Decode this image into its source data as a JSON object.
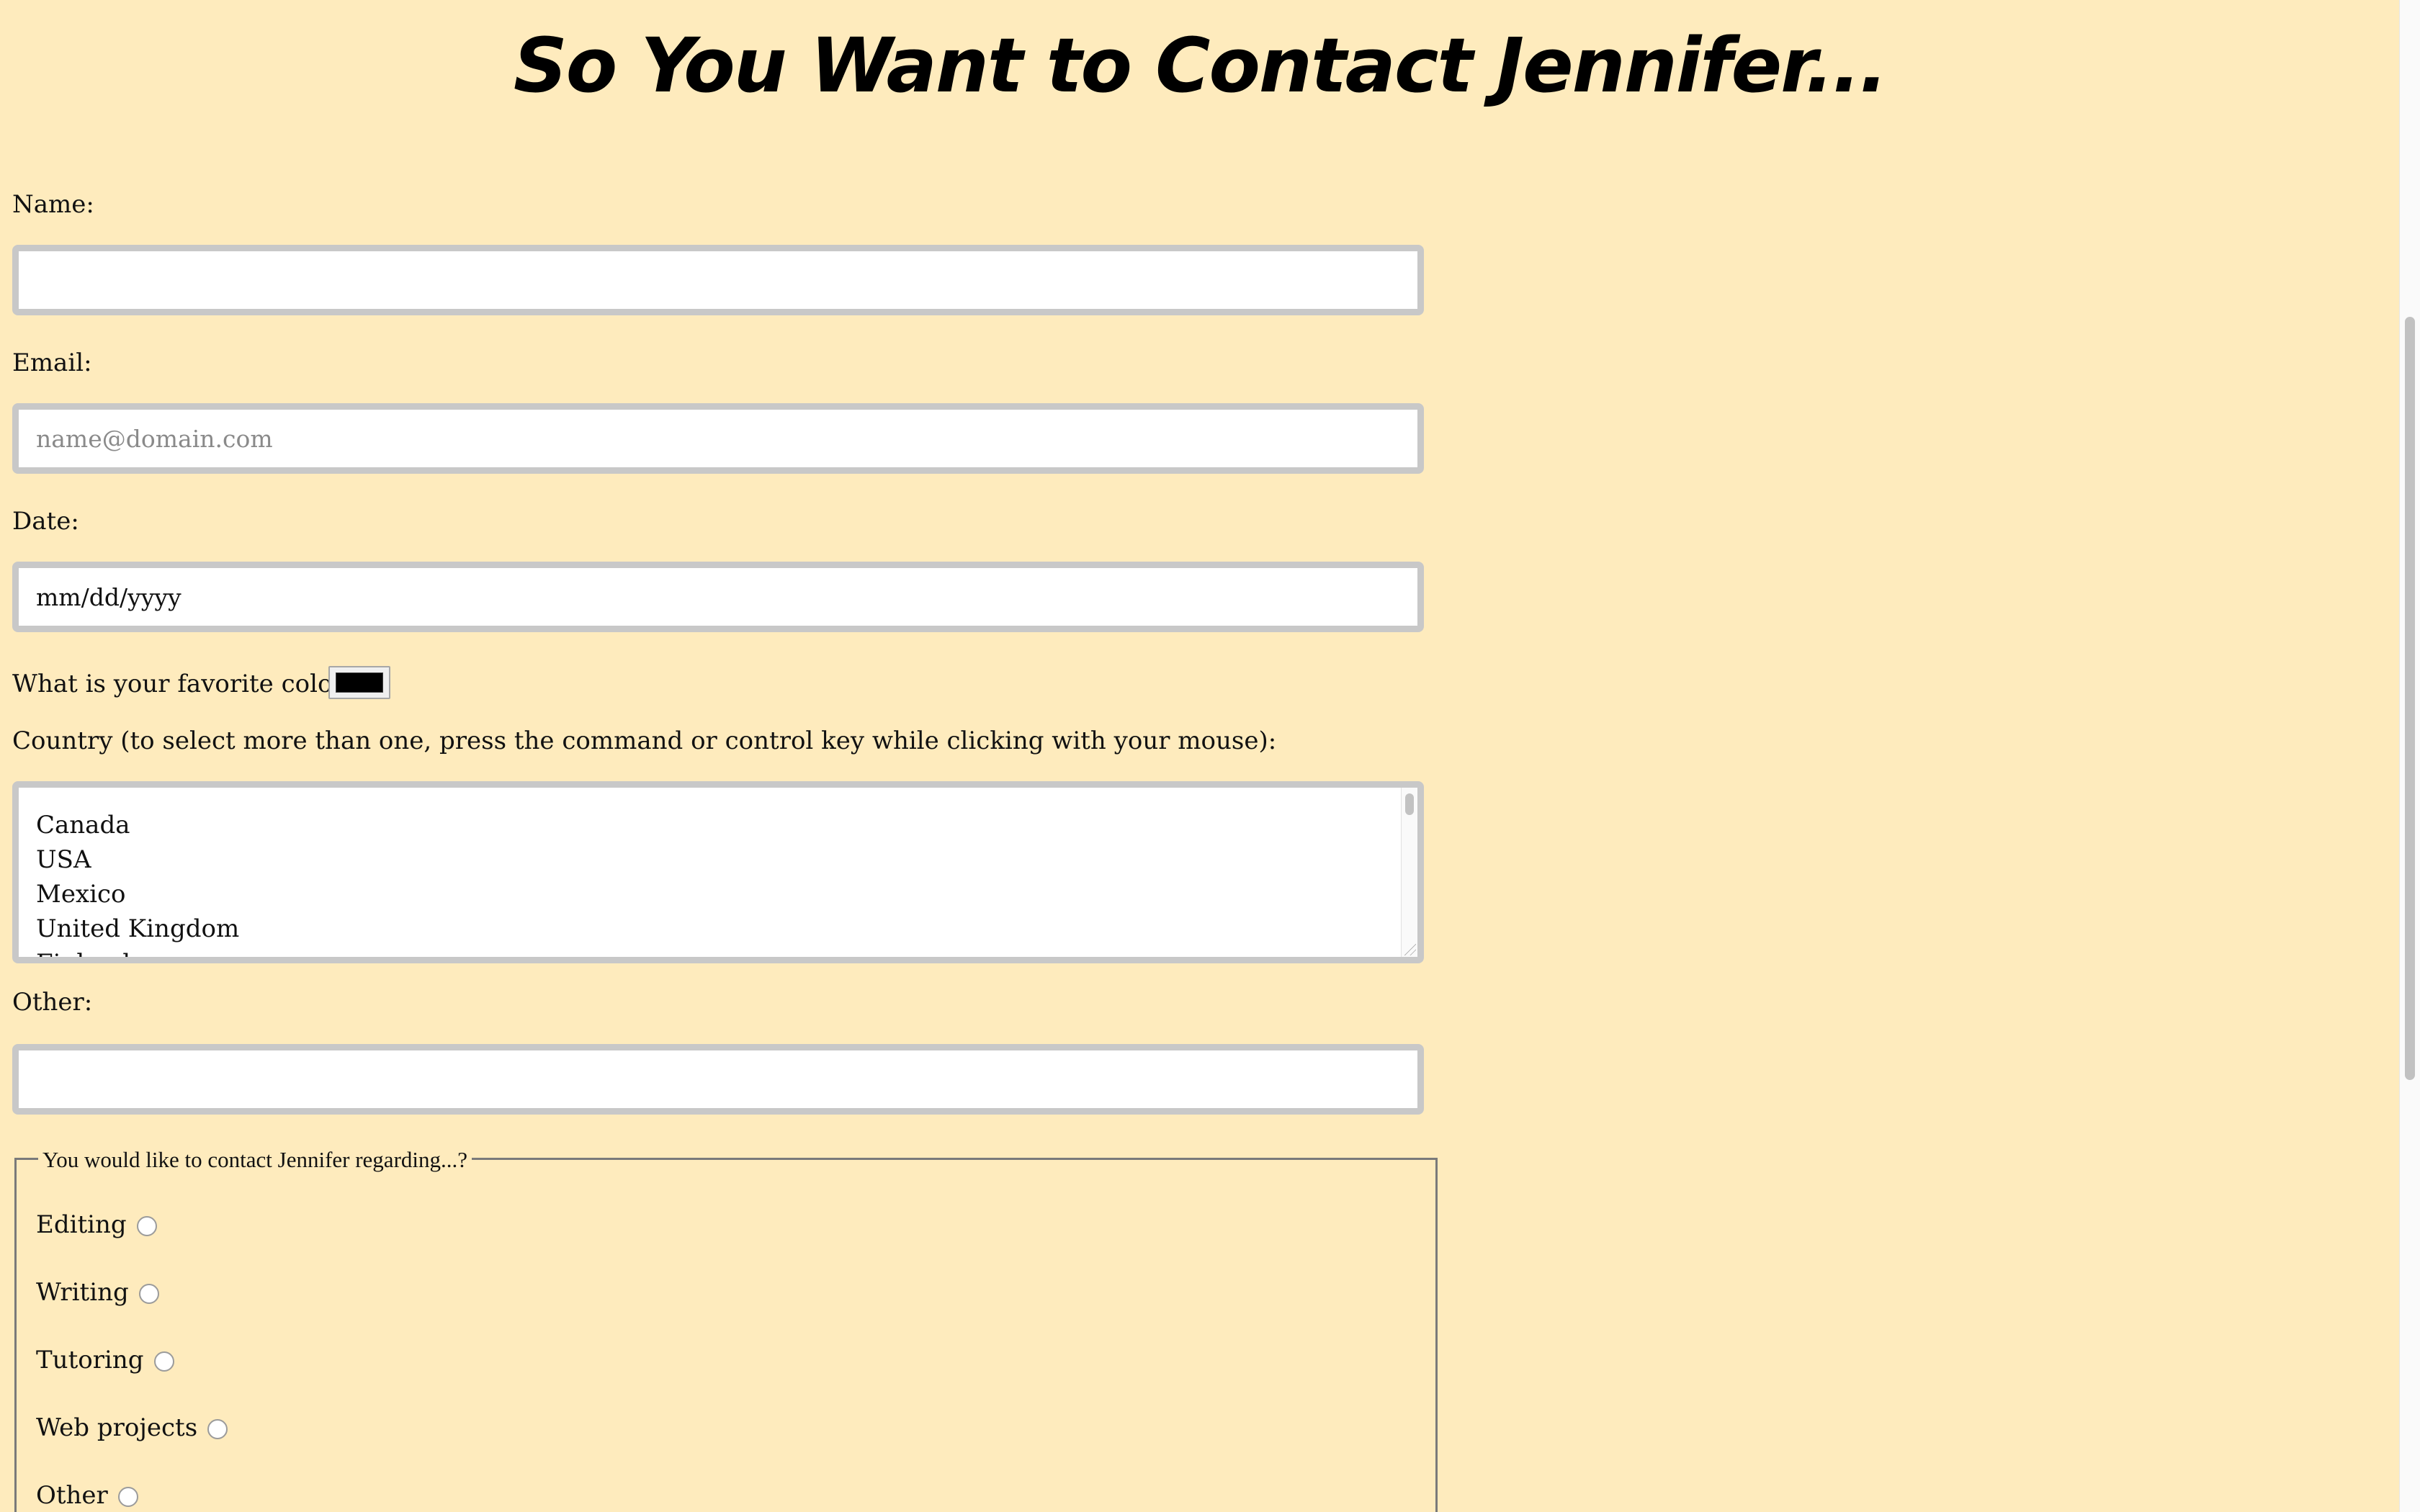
{
  "page": {
    "title": "So You Want to Contact Jennifer...",
    "background_color": "#feebbd"
  },
  "form": {
    "name": {
      "label": "Name:",
      "value": "",
      "placeholder": ""
    },
    "email": {
      "label": "Email:",
      "value": "",
      "placeholder": "name@domain.com"
    },
    "date": {
      "label": "Date:",
      "value": "mm/dd/yyyy"
    },
    "favorite_color": {
      "label": "What is your favorite color?",
      "value": "#000000"
    },
    "country": {
      "label": "Country (to select more than one, press the command or control key while clicking with your mouse):",
      "options": [
        "Canada",
        "USA",
        "Mexico",
        "United Kingdom",
        "Finland"
      ]
    },
    "other": {
      "label": "Other:",
      "value": "",
      "placeholder": ""
    },
    "regarding": {
      "legend": "You would like to contact Jennifer regarding...?",
      "options": [
        "Editing",
        "Writing",
        "Tutoring",
        "Web projects",
        "Other"
      ]
    }
  }
}
